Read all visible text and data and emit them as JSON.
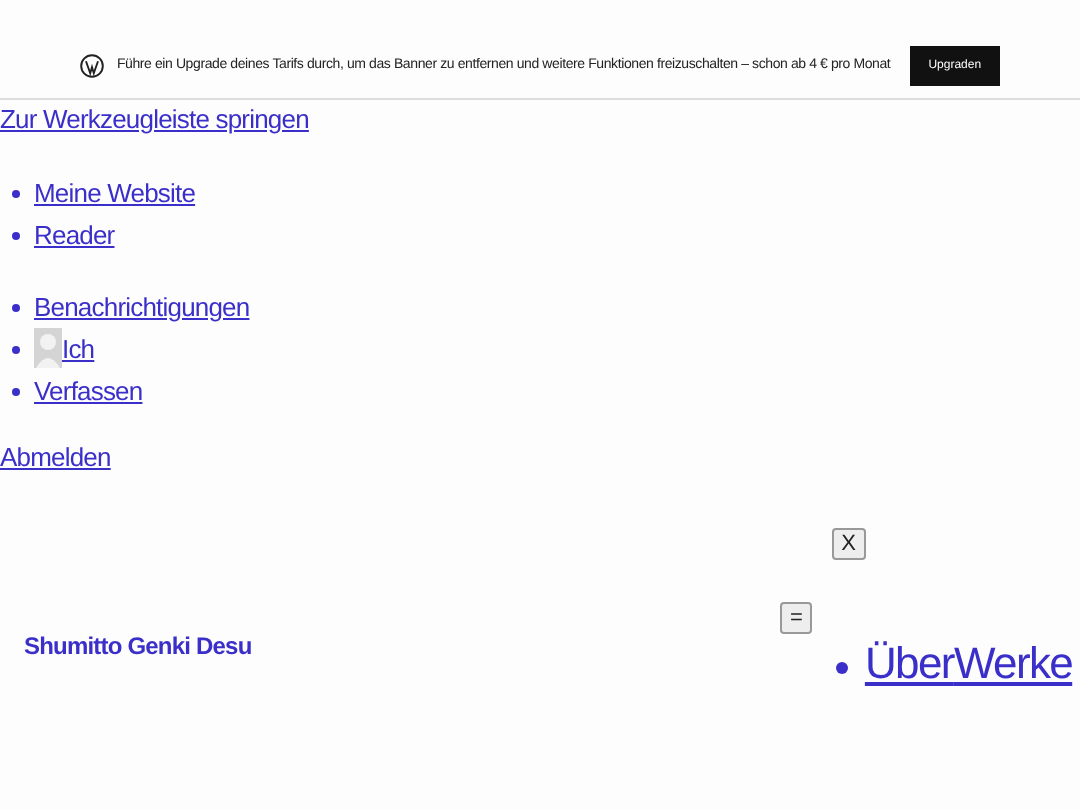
{
  "banner": {
    "message": "Führe ein Upgrade deines Tarifs durch, um das Banner zu entfernen und weitere Funktionen freizuschalten – schon ab 4 € pro Monat",
    "button": "Upgraden"
  },
  "skip_link": "Zur Werkzeugleiste springen",
  "toolbar_primary": [
    {
      "label": "Meine Website"
    },
    {
      "label": "Reader"
    }
  ],
  "toolbar_secondary": [
    {
      "label": "Benachrichtigungen",
      "kind": "link"
    },
    {
      "label": "Ich",
      "kind": "avatar"
    },
    {
      "label": "Verfassen",
      "kind": "link"
    }
  ],
  "logout": "Abmelden",
  "close_button": "X",
  "site_title": "Shumitto Genki Desu",
  "menu_button": "=",
  "nav": [
    {
      "label": "Über"
    },
    {
      "label": "Werke"
    }
  ]
}
